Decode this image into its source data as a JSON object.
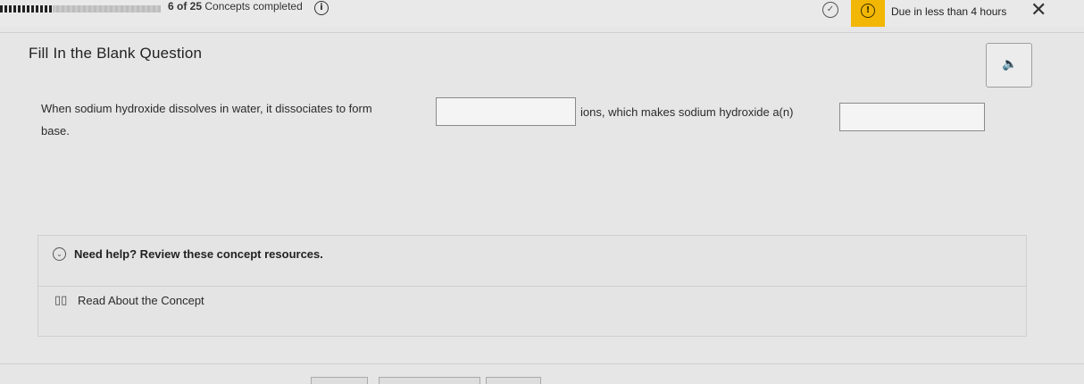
{
  "header": {
    "progress": {
      "completed": 6,
      "total": 25,
      "fraction": 0.24
    },
    "progress_label_count": "6 of 25",
    "progress_label_rest": " Concepts completed",
    "info_icon": "info-icon",
    "due_text": "Due in less than 4 hours",
    "colors": {
      "due_badge": "#f2b705"
    }
  },
  "question": {
    "title": "Fill In the Blank Question",
    "text_part1": "When sodium hydroxide dissolves in water, it dissociates to form",
    "text_part2": "ions, which makes sodium hydroxide a(n)",
    "text_part3": "base.",
    "blank1_value": "",
    "blank2_value": ""
  },
  "help": {
    "title": "Need help? Review these concept resources.",
    "resources": [
      {
        "label": "Read About the Concept",
        "icon": "book-icon"
      }
    ]
  }
}
